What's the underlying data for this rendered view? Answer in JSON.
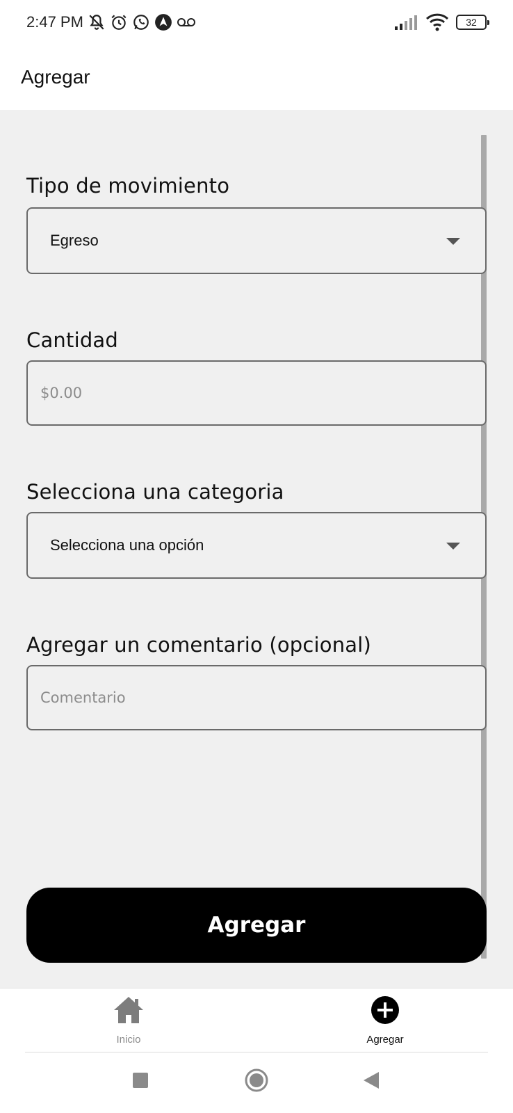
{
  "status_bar": {
    "time": "2:47 PM",
    "battery_level": "32",
    "icons": [
      "bell-off-icon",
      "alarm-icon",
      "whatsapp-icon",
      "nav-arrow-icon",
      "voicemail-icon",
      "signal-icon",
      "wifi-icon",
      "battery-icon"
    ]
  },
  "header": {
    "title": "Agregar"
  },
  "form": {
    "tipo_label": "Tipo de movimiento",
    "tipo_value": "Egreso",
    "cantidad_label": "Cantidad",
    "cantidad_placeholder": "$0.00",
    "categoria_label": "Selecciona una categoria",
    "categoria_value": "Selecciona una opción",
    "comentario_label": "Agregar un comentario (opcional)",
    "comentario_placeholder": "Comentario",
    "submit_label": "Agregar"
  },
  "tabs": [
    {
      "label": "Inicio",
      "icon": "home-icon",
      "active": false
    },
    {
      "label": "Agregar",
      "icon": "plus-circle-icon",
      "active": true
    }
  ],
  "colors": {
    "background": "#f0f0f0",
    "button": "#000000",
    "field_border": "#6a6a6a",
    "placeholder": "#8c8c8c",
    "inactive_tab": "#8a8a8a"
  }
}
